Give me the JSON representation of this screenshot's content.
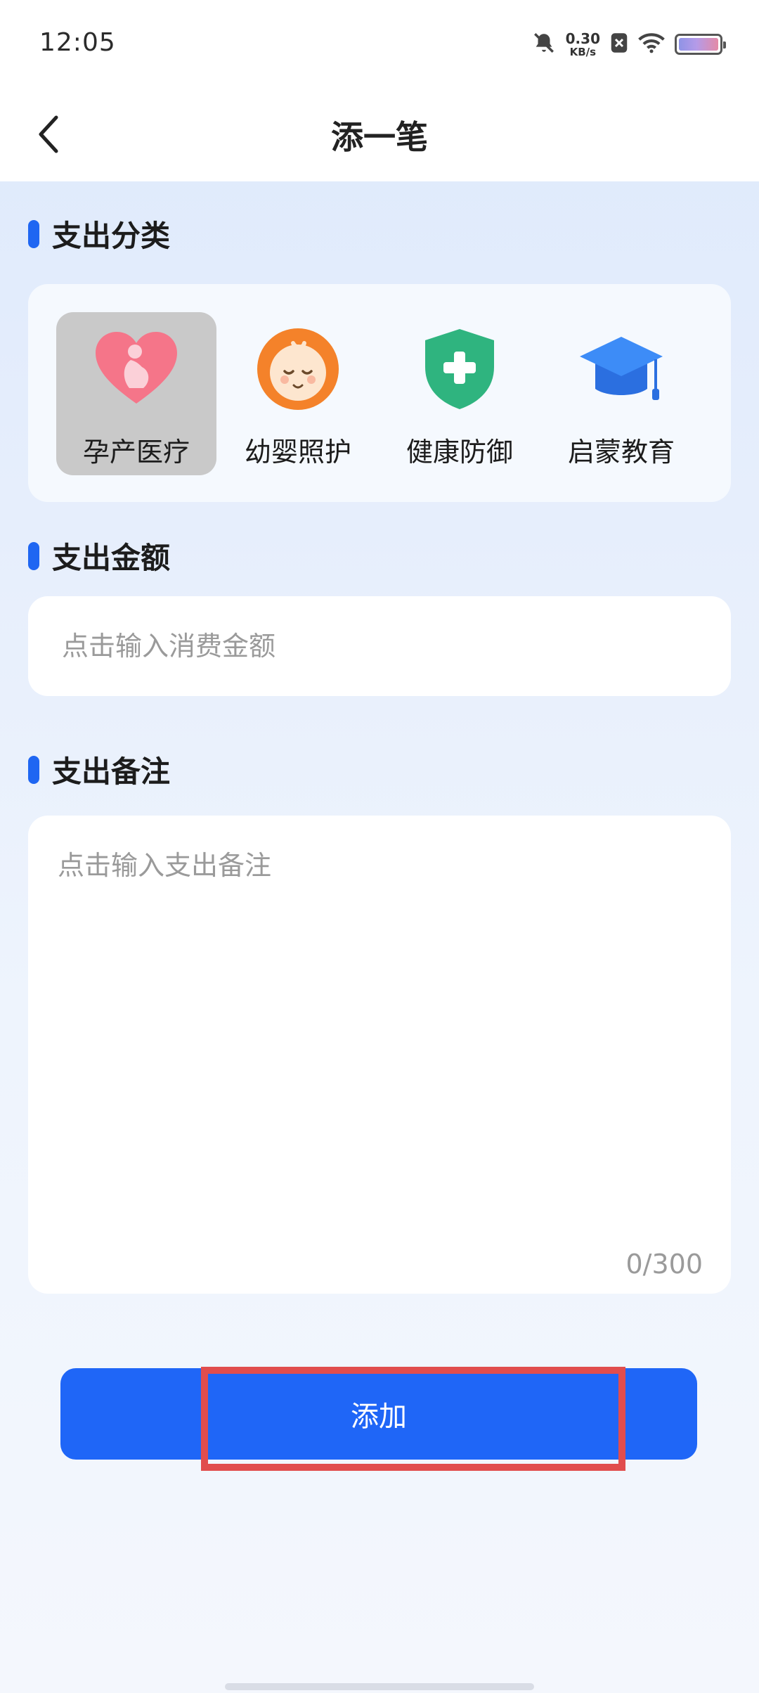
{
  "status_bar": {
    "time": "12:05",
    "net_speed_value": "0.30",
    "net_speed_unit": "KB/s",
    "icons": [
      "bell-muted-icon",
      "sim-blocked-icon",
      "wifi-icon",
      "battery-icon"
    ]
  },
  "header": {
    "back_icon": "chevron-left-icon",
    "title": "添一笔"
  },
  "category_section": {
    "title": "支出分类",
    "selected_index": 0,
    "items": [
      {
        "label": "孕产医疗",
        "icon": "pregnancy-heart-icon",
        "color": "#f57589"
      },
      {
        "label": "幼婴照护",
        "icon": "baby-face-icon",
        "color": "#f4822a"
      },
      {
        "label": "健康防御",
        "icon": "health-shield-icon",
        "color": "#2fb47f"
      },
      {
        "label": "启蒙教育",
        "icon": "graduation-cap-icon",
        "color": "#2f7ff2"
      }
    ]
  },
  "amount_section": {
    "title": "支出金额",
    "placeholder": "点击输入消费金额",
    "value": ""
  },
  "note_section": {
    "title": "支出备注",
    "placeholder": "点击输入支出备注",
    "value": "",
    "char_count": "0/300"
  },
  "submit": {
    "label": "添加"
  },
  "colors": {
    "accent": "#1f66f7",
    "highlight": "#e14d4d",
    "selected_bg": "#c9c9c9"
  }
}
